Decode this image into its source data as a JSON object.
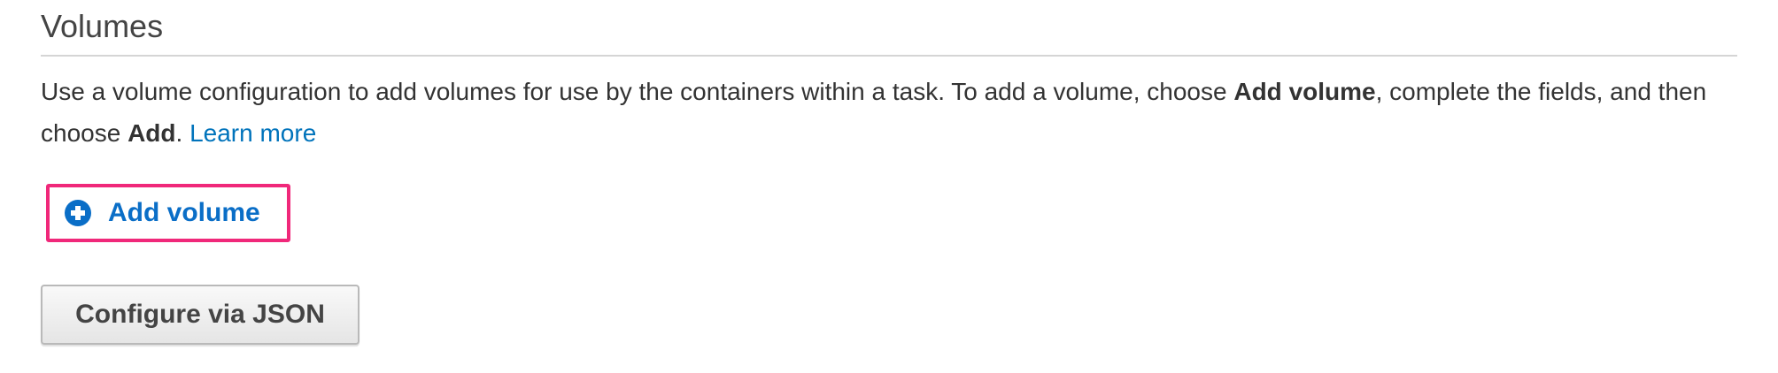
{
  "section": {
    "title": "Volumes",
    "description": {
      "part1": "Use a volume configuration to add volumes for use by the containers within a task. To add a volume, choose ",
      "bold1": "Add volume",
      "part2": ", complete the fields, and then choose ",
      "bold2": "Add",
      "part3": ". ",
      "learn_more": "Learn more"
    }
  },
  "actions": {
    "add_volume_label": "Add volume",
    "add_volume_icon": "plus-circle-icon",
    "configure_json_label": "Configure via JSON"
  },
  "colors": {
    "link": "#0073bb",
    "highlight": "#f0287a",
    "text": "#333333"
  }
}
